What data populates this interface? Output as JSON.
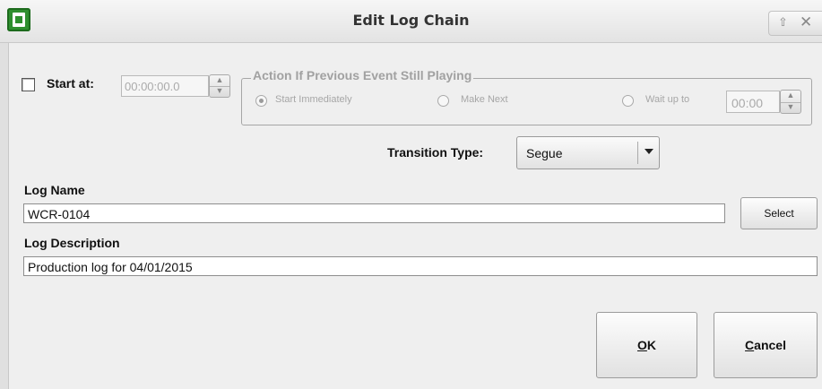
{
  "window": {
    "title": "Edit Log Chain"
  },
  "start": {
    "label": "Start at:",
    "checked": false,
    "time_value": "00:00:00.0"
  },
  "action_group": {
    "title": "Action If Previous Event Still Playing",
    "options": [
      {
        "label": "Start Immediately",
        "selected": true
      },
      {
        "label": "Make Next",
        "selected": false
      },
      {
        "label": "Wait up to",
        "selected": false
      }
    ],
    "wait_value": "00:00"
  },
  "transition": {
    "label": "Transition Type:",
    "value": "Segue"
  },
  "log_name": {
    "label": "Log Name",
    "value": "WCR-0104",
    "select_label": "Select"
  },
  "log_description": {
    "label": "Log Description",
    "value": "Production log for 04/01/2015"
  },
  "buttons": {
    "ok_mnemonic": "O",
    "ok_rest": "K",
    "cancel_mnemonic": "C",
    "cancel_rest": "ancel"
  },
  "icons": [
    "app-icon",
    "shade-icon",
    "close-icon",
    "spin-up-icon",
    "spin-down-icon",
    "dropdown-arrow-icon"
  ]
}
